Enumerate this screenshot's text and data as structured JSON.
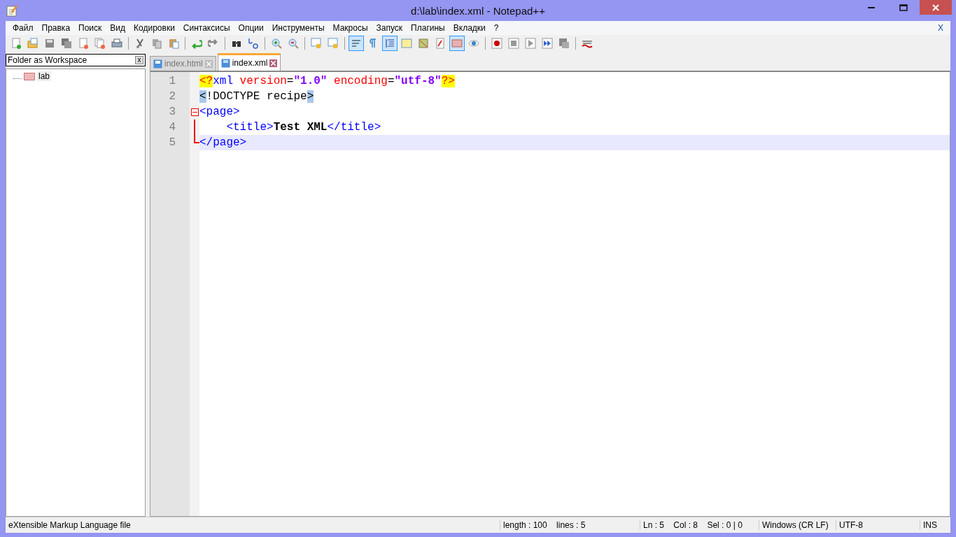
{
  "window": {
    "title": "d:\\lab\\index.xml - Notepad++"
  },
  "menu": [
    "Файл",
    "Правка",
    "Поиск",
    "Вид",
    "Кодировки",
    "Синтаксисы",
    "Опции",
    "Инструменты",
    "Макросы",
    "Запуск",
    "Плагины",
    "Вкладки",
    "?"
  ],
  "menu_close": "X",
  "toolbar": [
    {
      "kind": "new",
      "pressed": false
    },
    {
      "kind": "open",
      "pressed": false
    },
    {
      "kind": "save",
      "pressed": false
    },
    {
      "kind": "save-all",
      "pressed": false
    },
    {
      "kind": "close",
      "pressed": false
    },
    {
      "kind": "close-all",
      "pressed": false
    },
    {
      "kind": "print",
      "pressed": false
    },
    {
      "kind": "sep"
    },
    {
      "kind": "cut",
      "pressed": false
    },
    {
      "kind": "copy",
      "pressed": false
    },
    {
      "kind": "paste",
      "pressed": false
    },
    {
      "kind": "sep"
    },
    {
      "kind": "undo",
      "pressed": false
    },
    {
      "kind": "redo",
      "pressed": false
    },
    {
      "kind": "sep"
    },
    {
      "kind": "find",
      "pressed": false
    },
    {
      "kind": "replace",
      "pressed": false
    },
    {
      "kind": "sep"
    },
    {
      "kind": "zoom-in",
      "pressed": false
    },
    {
      "kind": "zoom-out",
      "pressed": false
    },
    {
      "kind": "sep"
    },
    {
      "kind": "sync-v",
      "pressed": false
    },
    {
      "kind": "sync-h",
      "pressed": false
    },
    {
      "kind": "sep"
    },
    {
      "kind": "wrap",
      "pressed": true
    },
    {
      "kind": "pilcrow",
      "pressed": false
    },
    {
      "kind": "indent-guide",
      "pressed": true
    },
    {
      "kind": "lang",
      "pressed": false
    },
    {
      "kind": "map",
      "pressed": false
    },
    {
      "kind": "func",
      "pressed": false
    },
    {
      "kind": "folder",
      "pressed": true
    },
    {
      "kind": "eye",
      "pressed": false
    },
    {
      "kind": "sep"
    },
    {
      "kind": "record",
      "pressed": false
    },
    {
      "kind": "stop",
      "pressed": false
    },
    {
      "kind": "play",
      "pressed": false
    },
    {
      "kind": "play-multi",
      "pressed": false
    },
    {
      "kind": "save-macro",
      "pressed": false
    },
    {
      "kind": "sep"
    },
    {
      "kind": "spell",
      "pressed": false
    }
  ],
  "sidebar": {
    "title": "Folder as Workspace",
    "close": "x",
    "items": [
      {
        "label": "lab",
        "expanded": false
      }
    ]
  },
  "tabs": [
    {
      "label": "index.html",
      "selected": false
    },
    {
      "label": "index.xml",
      "selected": true
    }
  ],
  "editor": {
    "lines": [
      {
        "number": "1",
        "current": false,
        "kind": "plain",
        "tokens": [
          {
            "kind": "pi",
            "text": "<?"
          },
          {
            "kind": "tag",
            "text": "xml"
          },
          {
            "kind": "attr",
            "text": " version"
          },
          {
            "kind": "plain",
            "text": "="
          },
          {
            "kind": "value",
            "text": "\"1.0\""
          },
          {
            "kind": "attr",
            "text": " encoding"
          },
          {
            "kind": "plain",
            "text": "="
          },
          {
            "kind": "value",
            "text": "\"utf-8\""
          },
          {
            "kind": "pi",
            "text": "?>"
          }
        ]
      },
      {
        "number": "2",
        "current": false,
        "kind": "plain",
        "tokens": [
          {
            "kind": "match",
            "text": "<"
          },
          {
            "kind": "plain",
            "text": "!DOCTYPE recipe"
          },
          {
            "kind": "match",
            "text": ">"
          }
        ]
      },
      {
        "number": "3",
        "current": false,
        "kind": "fold-start",
        "tokens": [
          {
            "kind": "tag",
            "text": "<page>"
          }
        ]
      },
      {
        "number": "4",
        "current": false,
        "kind": "fold-body",
        "tokens": [
          {
            "kind": "tag",
            "text": "    <title>"
          },
          {
            "kind": "bold",
            "text": "Test XML"
          },
          {
            "kind": "tag",
            "text": "</title>"
          }
        ]
      },
      {
        "number": "5",
        "current": true,
        "kind": "fold-end",
        "tokens": [
          {
            "kind": "tag",
            "text": "</page>"
          }
        ]
      }
    ]
  },
  "status_bar": [
    "eXtensible Markup Language file",
    "length : 100    lines : 5",
    "Ln : 5    Col : 8    Sel : 0 | 0",
    "Windows (CR LF)",
    "UTF-8",
    "INS"
  ]
}
